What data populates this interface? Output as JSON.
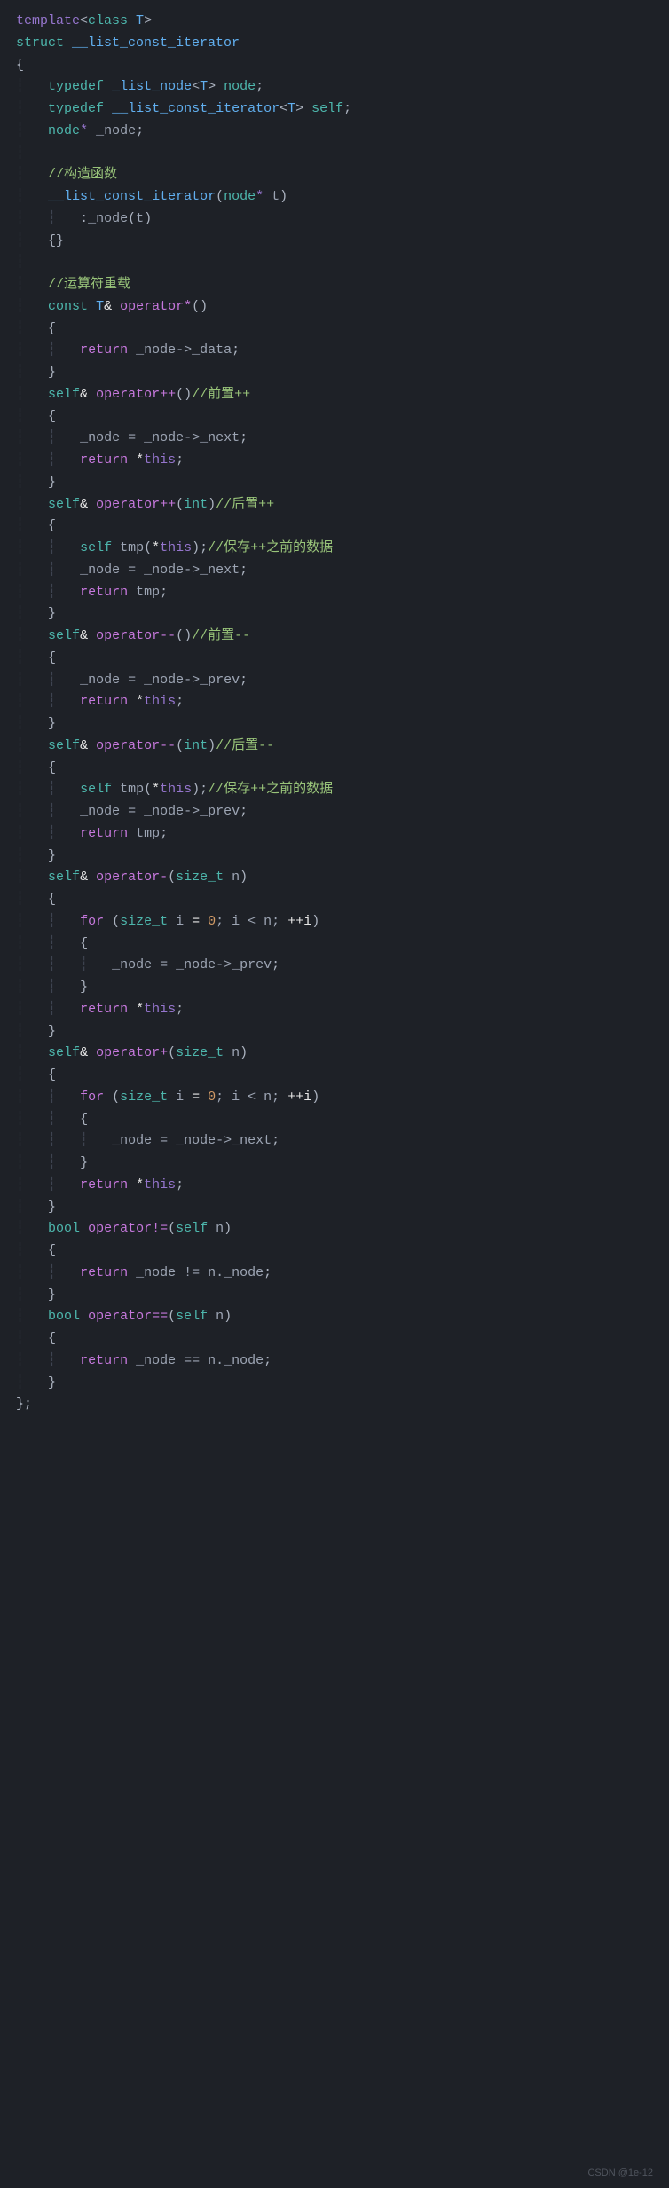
{
  "code": {
    "line1_template": "template",
    "line1_open": "<",
    "line1_class": "class",
    "line1_T": " T",
    "line1_close": ">",
    "line2_struct": "struct",
    "line2_name": " __list_const_iterator",
    "line3_brace": "{",
    "line4_typedef": "typedef",
    "line4_type": " _list_node",
    "line4_T": "T",
    "line4_node": " node",
    "line5_typedef": "typedef",
    "line5_type": " __list_const_iterator",
    "line5_T": "T",
    "line5_self": " self",
    "line6_node": "node",
    "line6_ptr": "*",
    "line6_var": " _node",
    "comment_ctor": "//构造函数",
    "ctor_name": "__list_const_iterator",
    "ctor_param_type": "node",
    "ctor_param_ptr": "*",
    "ctor_param_name": " t",
    "ctor_init": "_node",
    "ctor_init_arg": "t",
    "comment_overload": "//运算符重载",
    "const": "const",
    "T_ref": " T",
    "op_star": " operator*",
    "return": "return",
    "node_data": " _node->_data",
    "self_ref": "self",
    "op_inc": " operator++",
    "comment_pre_inc": "//前置++",
    "assign_next": "_node = _node->_next",
    "ret_this": " *",
    "this": "this",
    "int": "int",
    "comment_post_inc": "//后置++",
    "tmp_decl": "self",
    "tmp_name": " tmp",
    "tmp_arg": "*",
    "comment_save": "//保存++之前的数据",
    "ret_tmp": " tmp",
    "op_dec": " operator--",
    "comment_pre_dec": "//前置--",
    "assign_prev": "_node = _node->_prev",
    "comment_post_dec": "//后置--",
    "op_minus": " operator-",
    "size_t": "size_t",
    "n": " n",
    "for": "for",
    "i": " i",
    "eq": " = ",
    "zero": "0",
    "lt": "; i < n; ",
    "inc_i": "++i",
    "op_plus": " operator+",
    "bool": "bool",
    "op_ne": " operator!=",
    "self_param": "self",
    "n_param": " n",
    "ret_ne": " _node != n._node",
    "op_eq": " operator==",
    "ret_eq": " _node == n._node",
    "close_brace": "}",
    "semi": ";"
  },
  "watermark": "CSDN @1e-12"
}
